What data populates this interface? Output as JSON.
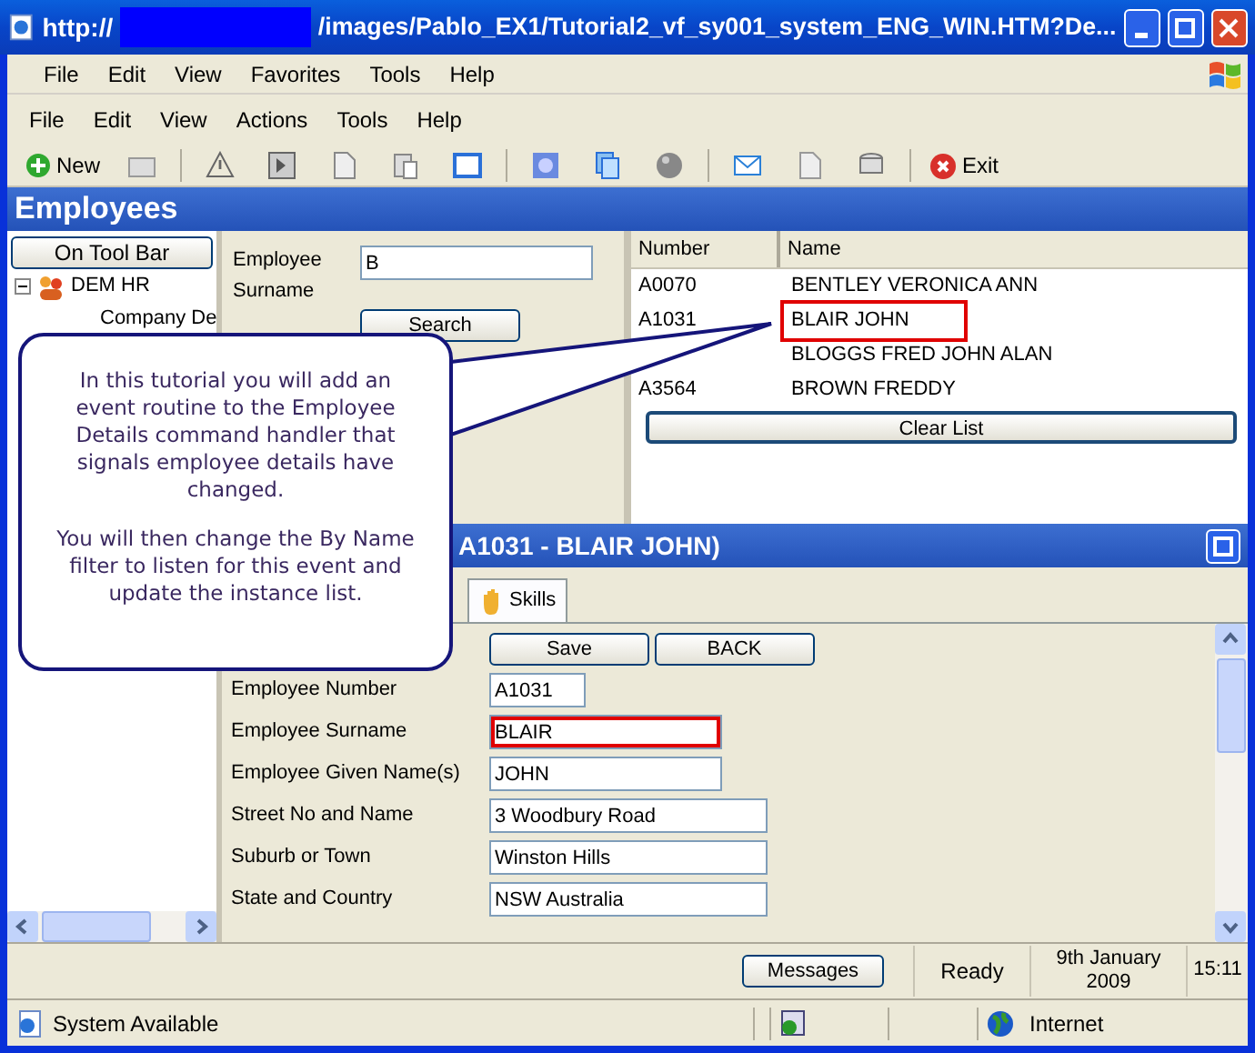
{
  "window": {
    "title_prefix": "http://",
    "title_path": "/images/Pablo_EX1/Tutorial2_vf_sy001_system_ENG_WIN.HTM?De..."
  },
  "browser_menu": [
    "File",
    "Edit",
    "View",
    "Favorites",
    "Tools",
    "Help"
  ],
  "app_menu": [
    "File",
    "Edit",
    "View",
    "Actions",
    "Tools",
    "Help"
  ],
  "toolbar": {
    "new_label": "New",
    "exit_label": "Exit"
  },
  "header": {
    "title": "Employees"
  },
  "sidebar": {
    "button": "On Tool Bar",
    "tree": [
      {
        "label": "DEM HR",
        "expanded": true,
        "children": [
          {
            "label": "Company De"
          }
        ]
      }
    ]
  },
  "search": {
    "label": "Employee Surname",
    "value": "B",
    "button": "Search"
  },
  "list": {
    "columns": [
      "Number",
      "Name"
    ],
    "rows": [
      {
        "number": "A0070",
        "name": "BENTLEY VERONICA ANN",
        "highlighted": false
      },
      {
        "number": "A1031",
        "name": "BLAIR JOHN",
        "highlighted": true
      },
      {
        "name": "BLOGGS FRED JOHN ALAN",
        "highlighted": false
      },
      {
        "number": "A3564",
        "name": "BROWN FREDDY",
        "highlighted": false
      }
    ],
    "button": "Clear List"
  },
  "detail": {
    "title": "A1031 - BLAIR JOHN)",
    "tabs": [
      {
        "label": "Skills",
        "selected": false
      }
    ],
    "buttons": [
      "Save",
      "BACK"
    ],
    "fields": [
      {
        "label": "Employee Number",
        "value": "A1031",
        "highlighted": false
      },
      {
        "label": "Employee Surname",
        "value": "BLAIR",
        "highlighted": true
      },
      {
        "label": "Employee Given Name(s)",
        "value": "JOHN",
        "highlighted": false
      },
      {
        "label": "Street No and Name",
        "value": "3 Woodbury Road",
        "highlighted": false
      },
      {
        "label": "Suburb or Town",
        "value": "Winston Hills",
        "highlighted": false
      },
      {
        "label": "State and Country",
        "value": "NSW Australia",
        "highlighted": false
      }
    ]
  },
  "callout": {
    "paragraphs": [
      "In this tutorial you will add an event routine to the Employee Details command handler that signals employee details have changed.",
      "You will then change the By Name filter to listen for this event and update the instance list."
    ]
  },
  "status_bar": {
    "button": "Messages",
    "status": "Ready",
    "date_line1": "9th January",
    "date_line2": "2009",
    "time": "15:11"
  },
  "browser_status": {
    "text": "System Available",
    "zone": "Internet"
  }
}
